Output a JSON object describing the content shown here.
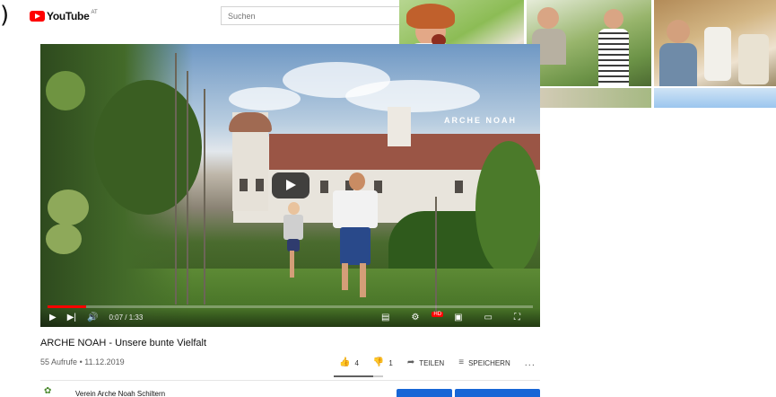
{
  "header": {
    "logo_text": "YouTube",
    "region": "AT",
    "search_placeholder": "Suchen"
  },
  "video": {
    "watermark": "ARCHE NOAH",
    "current_time": "0:07",
    "duration": "1:33",
    "time_separator": "/",
    "progress": 0.08
  },
  "info": {
    "title": "ARCHE NOAH - Unsere bunte Vielfalt",
    "views": "55 Aufrufe",
    "separator": "•",
    "date": "11.12.2019",
    "likes": "4",
    "dislikes": "1",
    "share_label": "TEILEN",
    "save_label": "SPEICHERN",
    "more_label": "..."
  },
  "channel": {
    "name": "Verein Arche Noah Schiltern"
  },
  "colors": {
    "brand_red": "#ff0000",
    "button_blue": "#1766d6"
  }
}
